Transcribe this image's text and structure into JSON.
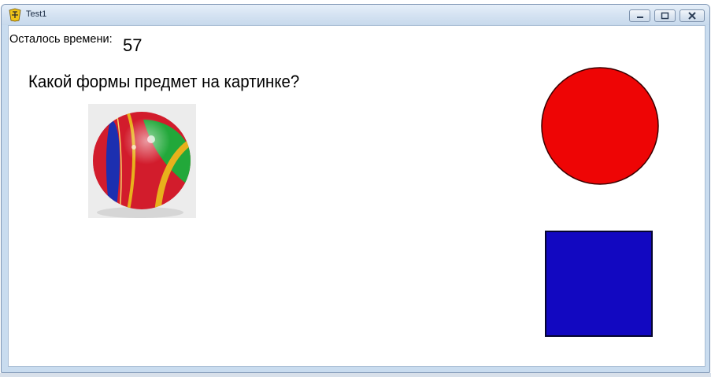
{
  "window": {
    "title": "Test1",
    "icon": "app-icon"
  },
  "title_buttons": {
    "minimize_icon": "minimize-icon",
    "maximize_icon": "maximize-icon",
    "close_icon": "close-icon"
  },
  "timer": {
    "label": "Осталось времени:",
    "value": "57"
  },
  "question": {
    "text": "Какой формы предмет на картинке?"
  },
  "picture": {
    "subject": "ball-photo",
    "colors": {
      "red": "#d21c2c",
      "green": "#22a83a",
      "blue": "#1c2fb0",
      "yellow": "#e8b11c"
    }
  },
  "answers": [
    {
      "shape": "circle",
      "color": "#ee0505"
    },
    {
      "shape": "square",
      "color": "#1208c1"
    }
  ]
}
